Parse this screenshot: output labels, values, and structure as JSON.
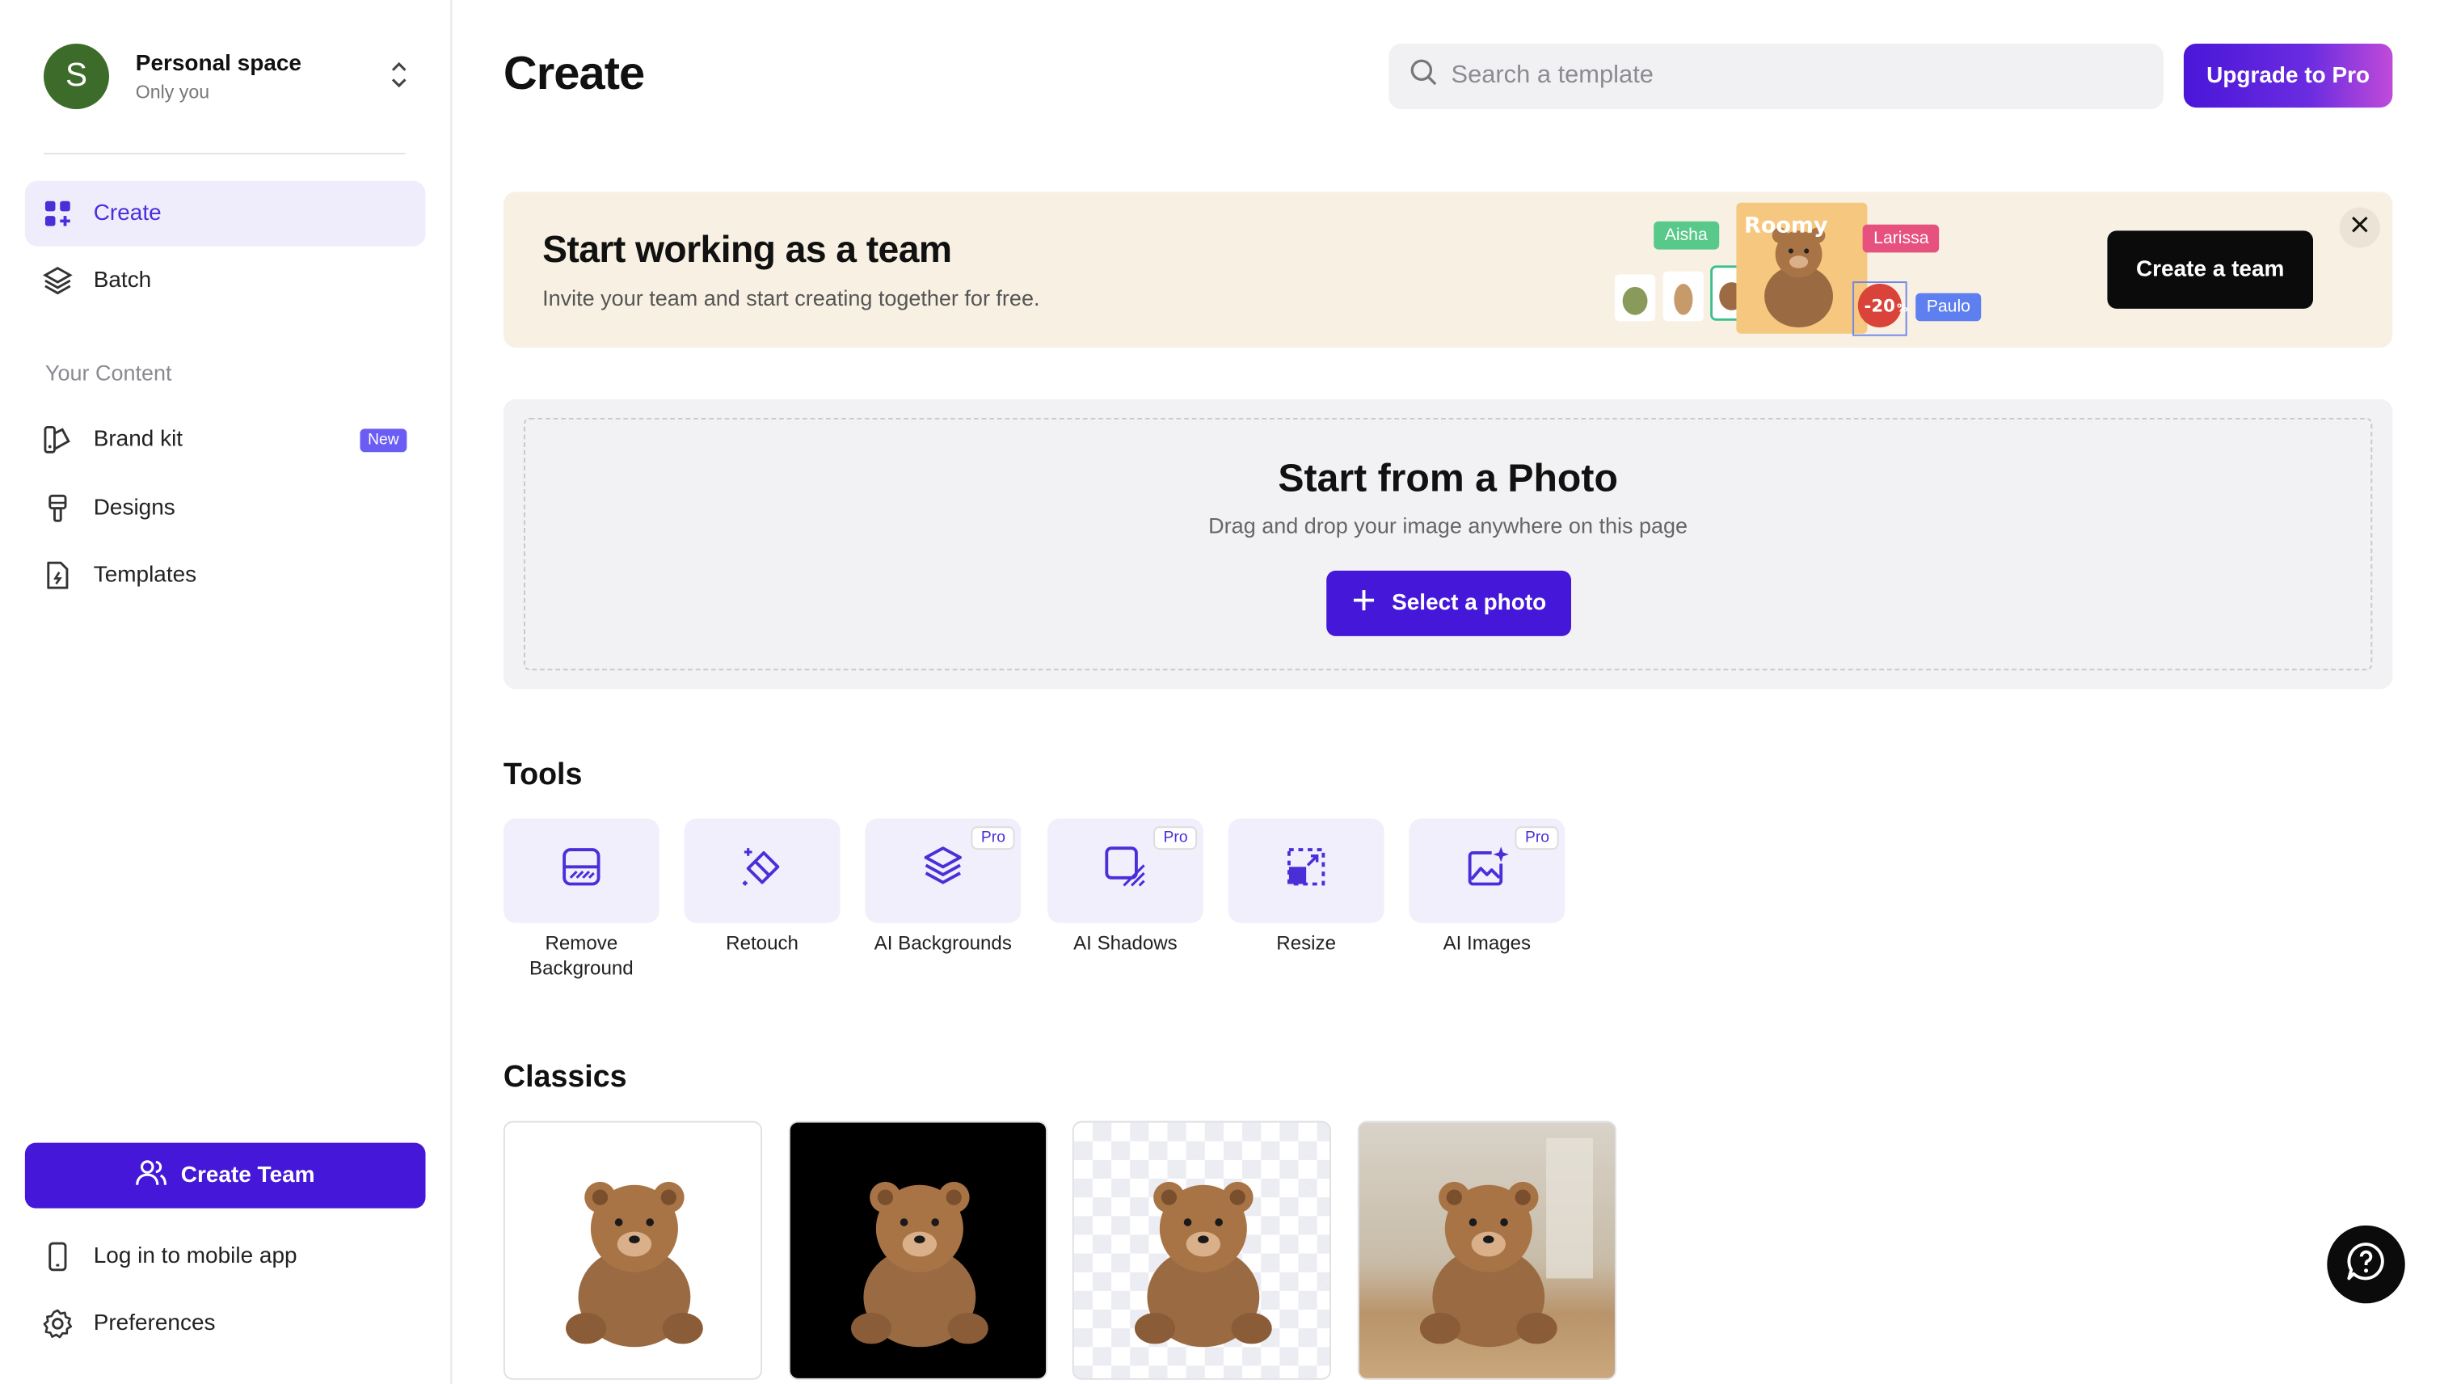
{
  "sidebar": {
    "space": {
      "avatar_letter": "S",
      "name": "Personal space",
      "subtitle": "Only you"
    },
    "nav": [
      {
        "label": "Create",
        "icon": "create-grid-icon",
        "active": true
      },
      {
        "label": "Batch",
        "icon": "layers-icon",
        "active": false
      }
    ],
    "section_label": "Your Content",
    "content_items": [
      {
        "label": "Brand kit",
        "icon": "brand-kit-icon",
        "badge": "New"
      },
      {
        "label": "Designs",
        "icon": "brush-icon"
      },
      {
        "label": "Templates",
        "icon": "template-file-icon"
      }
    ],
    "create_team_label": "Create Team",
    "mobile_label": "Log in to mobile app",
    "preferences_label": "Preferences"
  },
  "header": {
    "title": "Create",
    "search_placeholder": "Search a template",
    "upgrade_label": "Upgrade to Pro"
  },
  "banner": {
    "title": "Start working as a team",
    "subtitle": "Invite your team and start creating together for free.",
    "cta": "Create a team",
    "art": {
      "brand_word": "Roomy",
      "discount": "-20",
      "names": [
        "Aisha",
        "Larissa",
        "Paulo"
      ]
    }
  },
  "upload": {
    "title": "Start from a Photo",
    "subtitle": "Drag and drop your image anywhere on this page",
    "button": "Select a photo"
  },
  "tools": {
    "heading": "Tools",
    "items": [
      {
        "label": "Remove Background",
        "icon": "remove-background-icon",
        "pro": false
      },
      {
        "label": "Retouch",
        "icon": "eraser-sparkle-icon",
        "pro": false
      },
      {
        "label": "AI Backgrounds",
        "icon": "ai-layers-icon",
        "pro": true
      },
      {
        "label": "AI Shadows",
        "icon": "shadow-square-icon",
        "pro": true
      },
      {
        "label": "Resize",
        "icon": "resize-icon",
        "pro": false
      },
      {
        "label": "AI Images",
        "icon": "ai-image-icon",
        "pro": true
      }
    ],
    "pro_label": "Pro"
  },
  "classics": {
    "heading": "Classics",
    "items": [
      {
        "name": "white-background",
        "background": "#ffffff"
      },
      {
        "name": "black-background",
        "background": "#000000"
      },
      {
        "name": "transparent-background",
        "background": "checker"
      },
      {
        "name": "scene-background",
        "background": "#c9b49a"
      }
    ]
  },
  "colors": {
    "accent": "#4417d9",
    "active_bg": "#efedfb",
    "banner_bg": "#f8f0e3"
  }
}
